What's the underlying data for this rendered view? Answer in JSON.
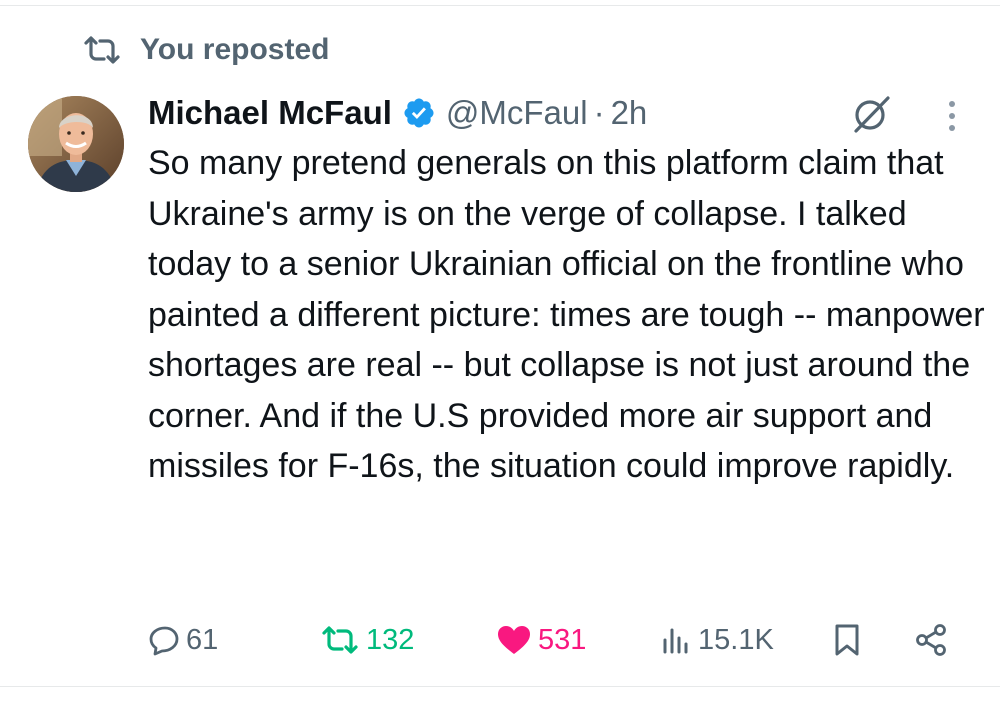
{
  "repost": {
    "label": "You reposted",
    "icon": "repost-icon"
  },
  "author": {
    "name": "Michael McFaul",
    "verified": true,
    "handle": "@McFaul",
    "separator": "·",
    "time": "2h"
  },
  "tweet": {
    "text": "So many pretend generals on this platform claim that Ukraine's army is on the verge of collapse. I talked today to a senior Ukrainian official on the frontline who painted a different picture: times are tough -- manpower shortages are real -- but collapse is not just around the corner. And if the U.S provided more air support and missiles for F-16s, the situation could improve rapidly."
  },
  "actions": {
    "replies": "61",
    "reposts": "132",
    "likes": "531",
    "views": "15.1K"
  },
  "colors": {
    "text": "#0f1419",
    "muted": "#536471",
    "verified_blue": "#1d9bf0",
    "repost_green": "#00ba7c",
    "like_pink": "#f91880"
  }
}
